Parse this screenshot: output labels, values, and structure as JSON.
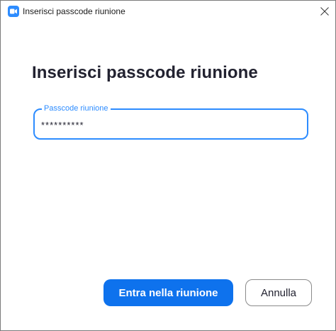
{
  "window": {
    "title": "Inserisci passcode riunione"
  },
  "main": {
    "heading": "Inserisci passcode riunione",
    "passcode_field": {
      "label": "Passcode riunione",
      "value": "**********"
    }
  },
  "actions": {
    "join_label": "Entra nella riunione",
    "cancel_label": "Annulla"
  },
  "colors": {
    "accent": "#2d8cff",
    "primary_button": "#0e72ed",
    "heading_text": "#222230"
  },
  "icons": {
    "app": "zoom-camera-icon",
    "close": "close-icon"
  }
}
